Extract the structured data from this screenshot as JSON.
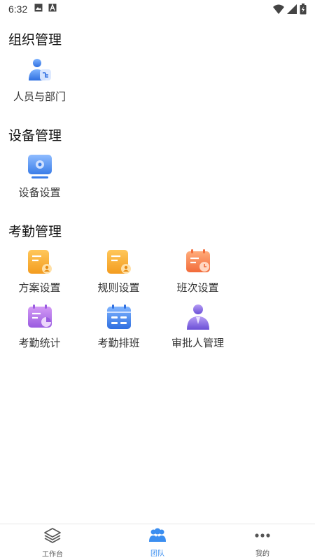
{
  "status_bar": {
    "time": "6:32"
  },
  "sections": [
    {
      "title": "组织管理",
      "items": [
        {
          "label": "人员与部门",
          "icon": "people-department-icon"
        }
      ]
    },
    {
      "title": "设备管理",
      "items": [
        {
          "label": "设备设置",
          "icon": "device-settings-icon"
        }
      ]
    },
    {
      "title": "考勤管理",
      "items": [
        {
          "label": "方案设置",
          "icon": "plan-settings-icon"
        },
        {
          "label": "规则设置",
          "icon": "rule-settings-icon"
        },
        {
          "label": "班次设置",
          "icon": "shift-settings-icon"
        },
        {
          "label": "考勤统计",
          "icon": "attendance-stats-icon"
        },
        {
          "label": "考勤排班",
          "icon": "attendance-schedule-icon"
        },
        {
          "label": "审批人管理",
          "icon": "approver-management-icon"
        }
      ]
    }
  ],
  "tabbar": {
    "tabs": [
      {
        "label": "工作台",
        "icon": "layers-icon",
        "active": false
      },
      {
        "label": "团队",
        "icon": "team-icon",
        "active": true
      },
      {
        "label": "我的",
        "icon": "more-dots-icon",
        "active": false
      }
    ]
  },
  "colors": {
    "accent": "#3b8ef0",
    "orange": "#f5a623",
    "purple": "#a56be8"
  }
}
